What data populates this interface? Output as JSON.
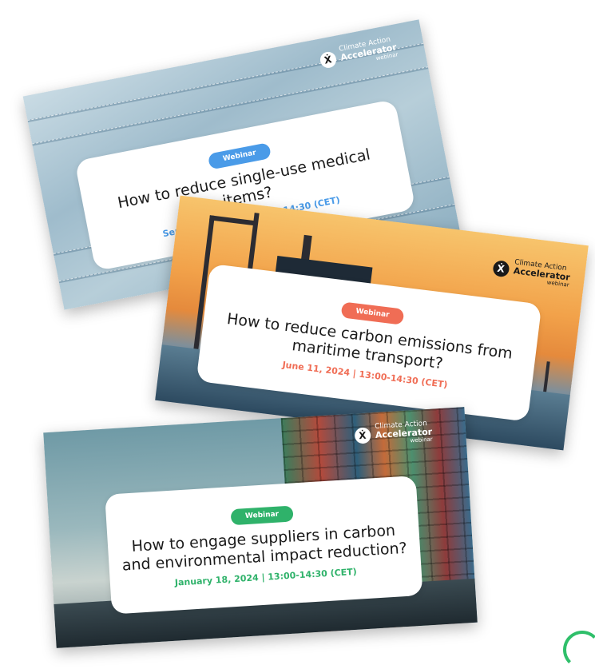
{
  "brand": {
    "line1": "Climate Action",
    "line2": "Accelerator",
    "line3": "webinar"
  },
  "colors": {
    "blue": "#4a9be8",
    "coral": "#f06d55",
    "green": "#2fb26a"
  },
  "cards": [
    {
      "badge": "Webinar",
      "title": "How to reduce single-use medical items?",
      "date": "September 2024 | 13:00-14:30 (CET)"
    },
    {
      "badge": "Webinar",
      "title_line1": "How to reduce carbon emissions from",
      "title_line2": "maritime transport?",
      "date": "June 11, 2024 | 13:00-14:30 (CET)"
    },
    {
      "badge": "Webinar",
      "title_line1": "How to engage suppliers in carbon",
      "title_line2": "and environmental impact reduction?",
      "date": "January 18, 2024 | 13:00-14:30 (CET)"
    }
  ]
}
